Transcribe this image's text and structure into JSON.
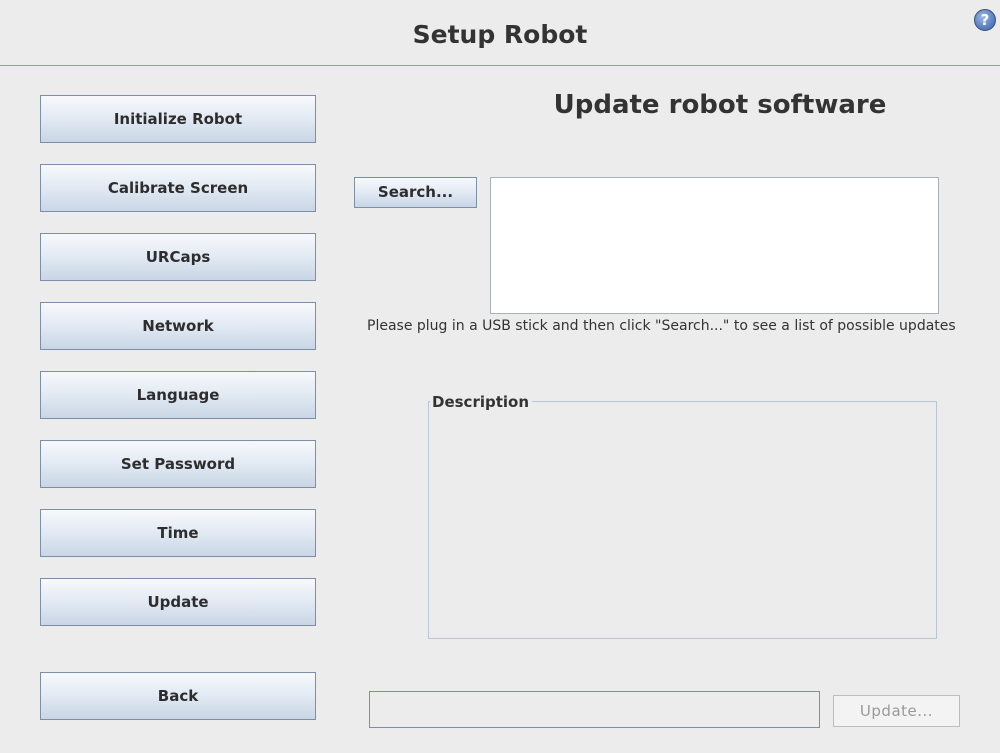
{
  "header": {
    "title": "Setup Robot",
    "help_icon": "?"
  },
  "sidebar": {
    "items": [
      {
        "label": "Initialize Robot"
      },
      {
        "label": "Calibrate Screen"
      },
      {
        "label": "URCaps"
      },
      {
        "label": "Network"
      },
      {
        "label": "Language"
      },
      {
        "label": "Set Password"
      },
      {
        "label": "Time"
      },
      {
        "label": "Update"
      }
    ],
    "back_label": "Back"
  },
  "main": {
    "title": "Update robot software",
    "search_label": "Search...",
    "hint": "Please plug in a USB stick and then click \"Search...\" to see a list of possible updates",
    "description_label": "Description",
    "path_value": "",
    "update_label": "Update..."
  }
}
